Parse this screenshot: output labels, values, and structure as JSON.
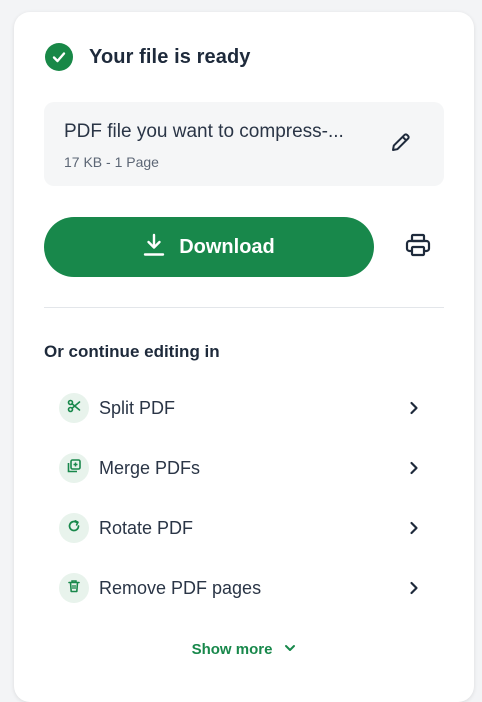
{
  "status": {
    "title": "Your file is ready"
  },
  "file": {
    "name": "PDF file you want to compress-...",
    "meta": "17 KB - 1 Page"
  },
  "actions": {
    "download_label": "Download"
  },
  "continue_section": {
    "title": "Or continue editing in",
    "items": [
      {
        "label": "Split PDF",
        "icon": "scissors-icon"
      },
      {
        "label": "Merge PDFs",
        "icon": "merge-icon"
      },
      {
        "label": "Rotate PDF",
        "icon": "rotate-icon"
      },
      {
        "label": "Remove PDF pages",
        "icon": "trash-icon"
      }
    ],
    "show_more_label": "Show more"
  },
  "colors": {
    "accent": "#18884b",
    "icon_bg": "#e8f3ec",
    "text": "#1e2a3b"
  }
}
